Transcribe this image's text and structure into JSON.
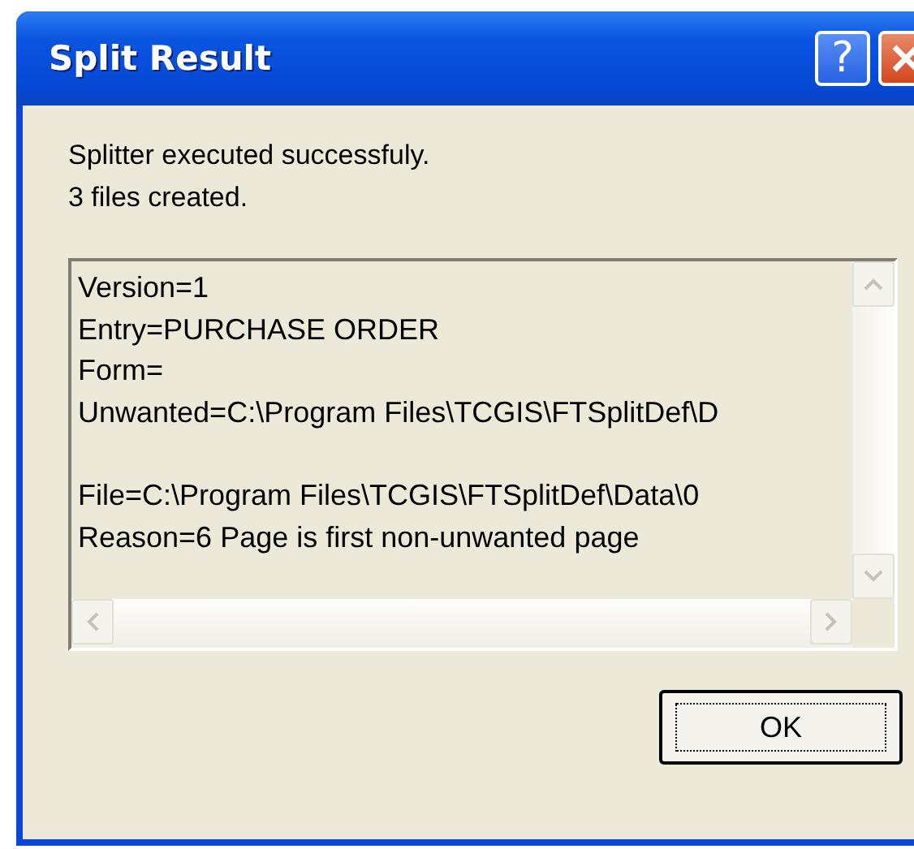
{
  "window": {
    "title": "Split Result",
    "help_button": "?"
  },
  "message": [
    "Splitter executed successfuly.",
    "3 files created."
  ],
  "output": {
    "blocks": [
      {
        "lines": [
          "Version=1",
          "Entry=PURCHASE ORDER",
          "Form=",
          "Unwanted=C:\\Program Files\\TCGIS\\FTSplitDef\\D"
        ]
      },
      {
        "lines": [
          "File=C:\\Program Files\\TCGIS\\FTSplitDef\\Data\\0",
          "Reason=6 Page is first non-unwanted page"
        ]
      }
    ]
  },
  "buttons": [
    {
      "label": "OK",
      "focused": true
    }
  ]
}
